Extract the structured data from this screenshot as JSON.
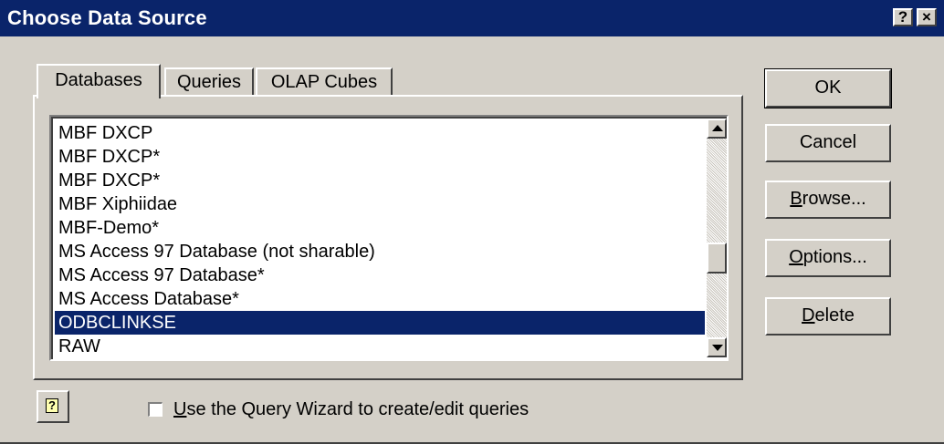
{
  "window": {
    "title": "Choose Data Source",
    "help_glyph": "?",
    "close_glyph": "×"
  },
  "tabs": [
    {
      "label": "Databases",
      "active": true
    },
    {
      "label": "Queries",
      "active": false
    },
    {
      "label": "OLAP Cubes",
      "active": false
    }
  ],
  "list": {
    "items": [
      "MBF DXCP",
      "MBF DXCP*",
      "MBF DXCP*",
      "MBF Xiphiidae",
      "MBF-Demo*",
      "MS Access 97 Database (not sharable)",
      "MS Access 97 Database*",
      "MS Access Database*",
      "ODBCLINKSE",
      "RAW"
    ],
    "selected": "ODBCLINKSE",
    "scroll_position": 0.62
  },
  "buttons": {
    "ok": "OK",
    "cancel": "Cancel",
    "browse": {
      "mnemonic": "B",
      "rest": "rowse..."
    },
    "options": {
      "mnemonic": "O",
      "rest": "ptions..."
    },
    "delete": {
      "mnemonic": "D",
      "rest": "elete"
    }
  },
  "query_wizard": {
    "mnemonic": "U",
    "rest": "se the Query Wizard to create/edit queries",
    "checked": false
  },
  "icons": {
    "context_help": "context-help-icon",
    "scroll_up": "scroll-up-arrow-icon",
    "scroll_down": "scroll-down-arrow-icon"
  },
  "colors": {
    "titlebar": "#0a246a",
    "face": "#d4d0c8",
    "selection": "#0a246a"
  }
}
